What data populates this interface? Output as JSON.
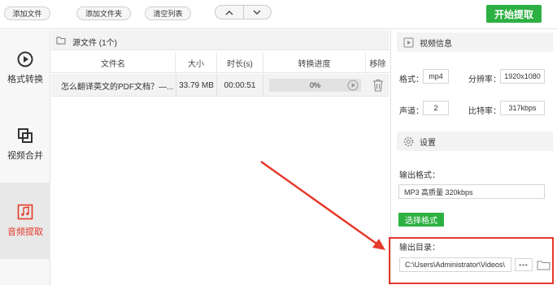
{
  "toolbar": {
    "add_file": "添加文件",
    "add_folder": "添加文件夹",
    "clear_list": "清空列表",
    "nav_up": "∧",
    "nav_down": "∨",
    "start": "开始提取"
  },
  "sidebar": {
    "items": [
      {
        "label": "格式转换",
        "icon": "play-circle-icon"
      },
      {
        "label": "视频合并",
        "icon": "merge-squares-icon"
      },
      {
        "label": "音频提取",
        "icon": "music-note-icon",
        "active": true
      }
    ]
  },
  "source": {
    "title": "源文件 (1个)"
  },
  "table": {
    "headers": [
      "文件名",
      "大小",
      "时长(s)",
      "转换进度",
      "移除"
    ],
    "rows": [
      {
        "name": "怎么翻译英文的PDF文档？—...",
        "size": "33.79 MB",
        "duration": "00:00:51",
        "progress": "0%"
      }
    ]
  },
  "video_info": {
    "title": "视频信息",
    "format_label": "格式：",
    "format_value": "mp4",
    "resolution_label": "分辨率：",
    "resolution_value": "1920x1080",
    "channels_label": "声道：",
    "channels_value": "2",
    "bitrate_label": "比特率：",
    "bitrate_value": "317kbps"
  },
  "settings": {
    "title": "设置",
    "output_format_label": "输出格式：",
    "output_format_value": "MP3 高质量 320kbps",
    "choose_format": "选择格式",
    "output_dir_label": "输出目录：",
    "output_dir_value": "C:\\Users\\Administrator\\Videos\\",
    "more": "•••"
  },
  "colors": {
    "accent_green": "#2db042",
    "highlight_red": "#e5392b"
  }
}
